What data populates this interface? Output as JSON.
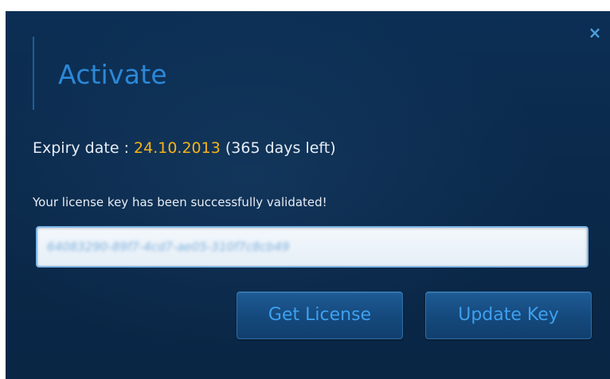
{
  "dialog": {
    "title": "Activate",
    "close_glyph": "×",
    "expiry": {
      "label": "Expiry date : ",
      "date": "24.10.2013",
      "days_prefix": " (",
      "days_count": "365",
      "days_suffix": " days left)"
    },
    "status_message": "Your license key has been successfully validated!",
    "license_key": {
      "value": "64083290-89f7-4cd7-ae05-310f7c8cb49",
      "blurred": true
    },
    "buttons": {
      "get_license": "Get License",
      "update_key": "Update Key"
    }
  },
  "colors": {
    "background": "#0b2a4c",
    "title": "#2b88d8",
    "date_highlight": "#f5b31a",
    "text": "#e6edf4",
    "button_text": "#3ea0ee",
    "close_icon": "#4e9fdc"
  },
  "icons": {
    "close": "close-icon"
  }
}
